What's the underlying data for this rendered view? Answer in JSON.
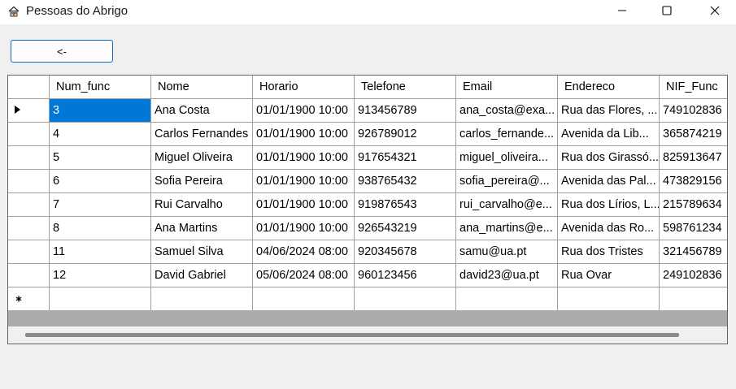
{
  "window": {
    "title": "Pessoas do Abrigo",
    "icon": "house-icon",
    "controls": [
      "minimize-icon",
      "maximize-icon",
      "close-icon"
    ]
  },
  "toolbar": {
    "back_label": "<-"
  },
  "grid": {
    "columns": [
      "Num_func",
      "Nome",
      "Horario",
      "Telefone",
      "Email",
      "Endereco",
      "NIF_Func"
    ],
    "rows": [
      [
        "3",
        "Ana Costa",
        "01/01/1900 10:00",
        "913456789",
        "ana_costa@exa...",
        "Rua das Flores, ...",
        "749102836"
      ],
      [
        "4",
        "Carlos Fernandes",
        "01/01/1900 10:00",
        "926789012",
        "carlos_fernande...",
        "Avenida da Lib...",
        "365874219"
      ],
      [
        "5",
        "Miguel Oliveira",
        "01/01/1900 10:00",
        "917654321",
        "miguel_oliveira...",
        "Rua dos Girassó...",
        "825913647"
      ],
      [
        "6",
        "Sofia Pereira",
        "01/01/1900 10:00",
        "938765432",
        "sofia_pereira@...",
        "Avenida das Pal...",
        "473829156"
      ],
      [
        "7",
        "Rui Carvalho",
        "01/01/1900 10:00",
        "919876543",
        "rui_carvalho@e...",
        "Rua dos Lírios, L...",
        "215789634"
      ],
      [
        "8",
        "Ana Martins",
        "01/01/1900 10:00",
        "926543219",
        "ana_martins@e...",
        "Avenida das Ro...",
        "598761234"
      ],
      [
        "11",
        "Samuel Silva",
        "04/06/2024 08:00",
        "920345678",
        "samu@ua.pt",
        "Rua dos Tristes",
        "321456789"
      ],
      [
        "12",
        "David Gabriel",
        "05/06/2024 08:00",
        "960123456",
        "david23@ua.pt",
        "Rua Ovar",
        "249102836"
      ]
    ],
    "selected_row": 0,
    "selected_column": 0,
    "current_row_indicator": "triangle-right-icon",
    "new_row_indicator": "asterisk-icon",
    "selection_color": "#0078d7"
  }
}
